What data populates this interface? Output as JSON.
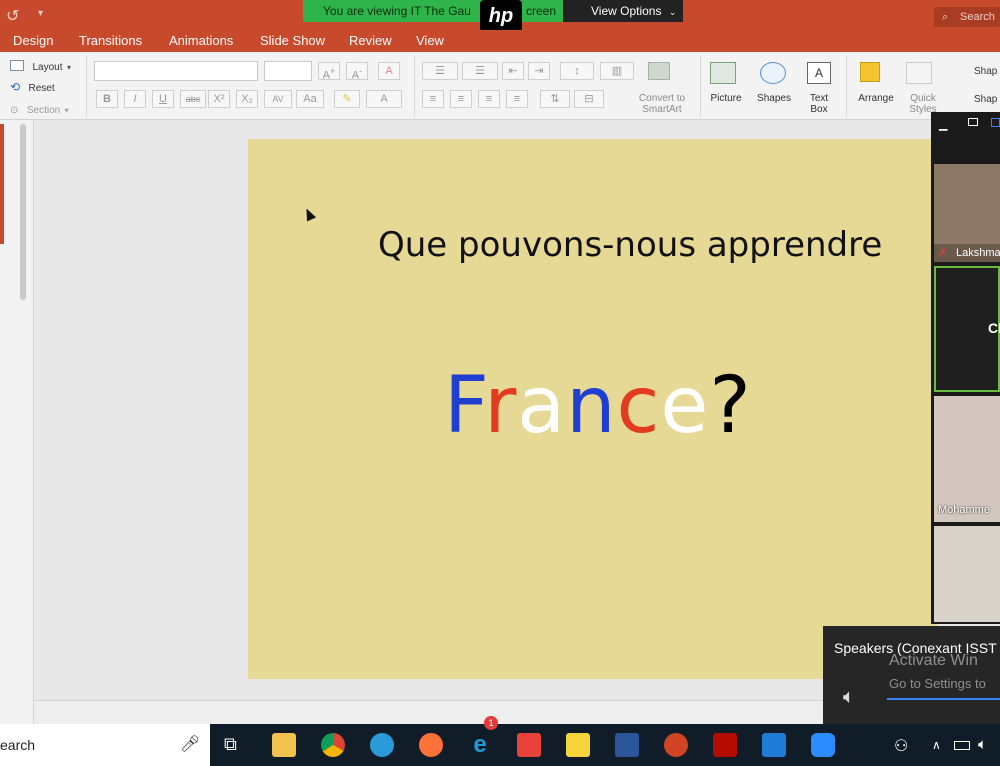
{
  "top": {
    "zoom_banner": "You are viewing IT The Gau",
    "zoom_banner_tail": "creen",
    "hp_logo": "hp",
    "view_options": "View Options",
    "search": "Search"
  },
  "tabs": [
    "Design",
    "Transitions",
    "Animations",
    "Slide Show",
    "Review",
    "View"
  ],
  "ribbon": {
    "layout": "Layout",
    "reset": "Reset",
    "section": "Section",
    "font_controls": [
      "B",
      "I",
      "U",
      "abc",
      "X²",
      "X₂",
      "AV",
      "Aa",
      "A"
    ],
    "convert_smartart": [
      "Convert to",
      "SmartArt"
    ],
    "picture": "Picture",
    "shapes": "Shapes",
    "text_box": [
      "Text",
      "Box"
    ],
    "arrange": "Arrange",
    "quick_styles": [
      "Quick",
      "Styles"
    ],
    "shape_labels": [
      "Shap",
      "Shap"
    ]
  },
  "slide": {
    "title": "Que pouvons-nous apprendre",
    "letters": [
      {
        "ch": "F",
        "color": "#1f3fd1"
      },
      {
        "ch": "r",
        "color": "#e23b1f"
      },
      {
        "ch": "a",
        "color": "#ffffff"
      },
      {
        "ch": "n",
        "color": "#1f3fd1"
      },
      {
        "ch": "c",
        "color": "#e23b1f"
      },
      {
        "ch": "e",
        "color": "#ffffff"
      },
      {
        "ch": "?",
        "color": "#000000"
      }
    ],
    "background": "#e6d895"
  },
  "video_panel": {
    "participants": [
      "Lakshma",
      "Ch",
      "Mohamme"
    ]
  },
  "speaker_popup": {
    "device": "Speakers (Conexant ISST",
    "watermark_1": "Activate Win",
    "watermark_2": "Go to Settings to"
  },
  "taskbar": {
    "search": "earch",
    "badge": "1"
  }
}
